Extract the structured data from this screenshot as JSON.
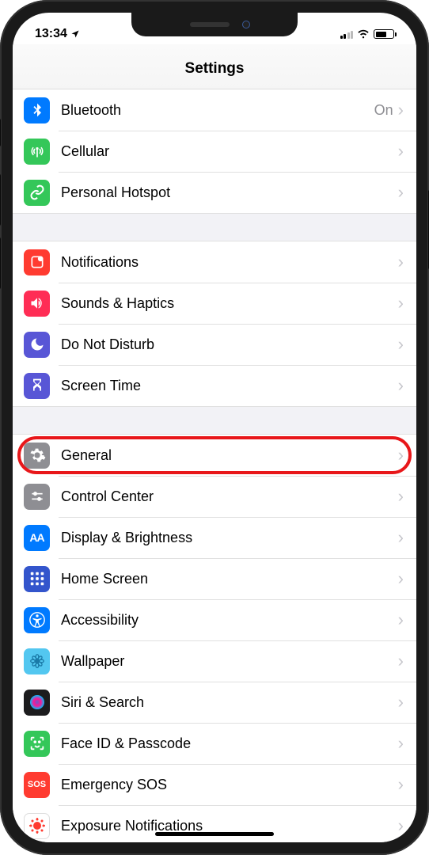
{
  "status": {
    "time": "13:34",
    "location_icon": "location-arrow",
    "wifi": true,
    "battery_pct": 55
  },
  "header": {
    "title": "Settings"
  },
  "groups": [
    {
      "rows": [
        {
          "id": "bluetooth",
          "label": "Bluetooth",
          "value": "On",
          "icon": "bluetooth",
          "color": "#007AFF"
        },
        {
          "id": "cellular",
          "label": "Cellular",
          "icon": "antenna",
          "color": "#34C759"
        },
        {
          "id": "hotspot",
          "label": "Personal Hotspot",
          "icon": "link",
          "color": "#34C759"
        }
      ]
    },
    {
      "rows": [
        {
          "id": "notifications",
          "label": "Notifications",
          "icon": "notification",
          "color": "#FF3B30"
        },
        {
          "id": "sounds",
          "label": "Sounds & Haptics",
          "icon": "speaker",
          "color": "#FF2D55"
        },
        {
          "id": "dnd",
          "label": "Do Not Disturb",
          "icon": "moon",
          "color": "#5856D6"
        },
        {
          "id": "screentime",
          "label": "Screen Time",
          "icon": "hourglass",
          "color": "#5856D6"
        }
      ]
    },
    {
      "rows": [
        {
          "id": "general",
          "label": "General",
          "icon": "gear",
          "color": "#8E8E93",
          "highlighted": true
        },
        {
          "id": "controlcenter",
          "label": "Control Center",
          "icon": "sliders",
          "color": "#8E8E93"
        },
        {
          "id": "display",
          "label": "Display & Brightness",
          "icon": "textsize",
          "color": "#007AFF"
        },
        {
          "id": "homescreen",
          "label": "Home Screen",
          "icon": "grid",
          "color": "#3355CC"
        },
        {
          "id": "accessibility",
          "label": "Accessibility",
          "icon": "accessibility",
          "color": "#007AFF"
        },
        {
          "id": "wallpaper",
          "label": "Wallpaper",
          "icon": "flower",
          "color": "#53C7F0"
        },
        {
          "id": "siri",
          "label": "Siri & Search",
          "icon": "siri",
          "color": "#1C1C1E"
        },
        {
          "id": "faceid",
          "label": "Face ID & Passcode",
          "icon": "faceid",
          "color": "#34C759"
        },
        {
          "id": "sos",
          "label": "Emergency SOS",
          "icon": "sos",
          "color": "#FF3B30",
          "text": "SOS"
        },
        {
          "id": "exposure",
          "label": "Exposure Notifications",
          "icon": "covid",
          "color": "#FFFFFF",
          "icon_color": "#FF3B30",
          "border": true
        }
      ]
    }
  ]
}
